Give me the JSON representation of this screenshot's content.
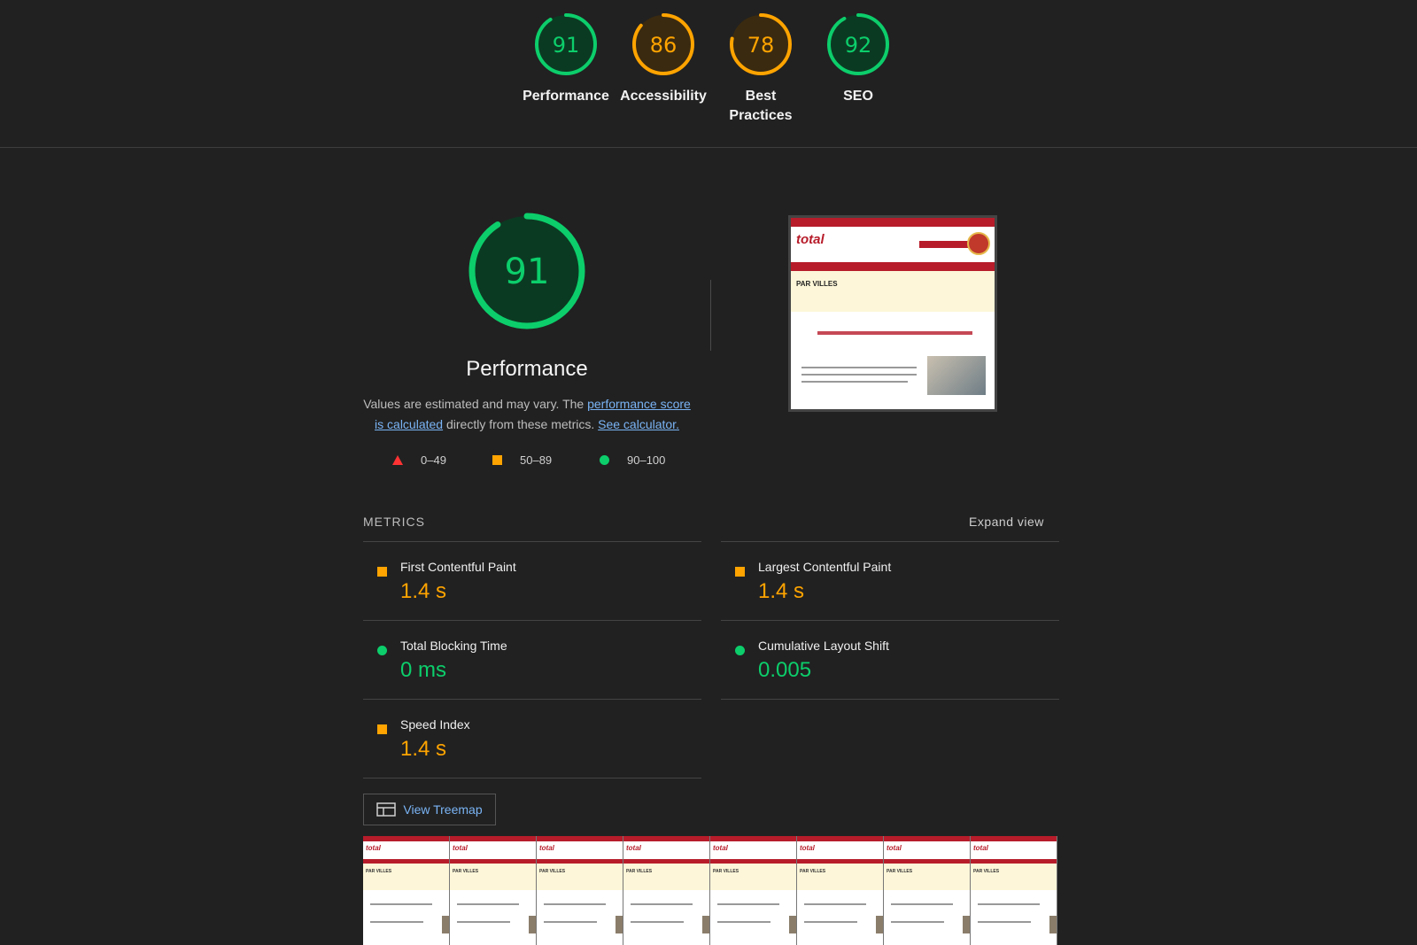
{
  "gauges": [
    {
      "score": 91,
      "label": "Performance",
      "color": "#0cce6b",
      "fill": "#0b3a22"
    },
    {
      "score": 86,
      "label": "Accessibility",
      "color": "#ffa400",
      "fill": "#3a2a10"
    },
    {
      "score": 78,
      "label": "Best Practices",
      "color": "#ffa400",
      "fill": "#3a2a10"
    },
    {
      "score": 92,
      "label": "SEO",
      "color": "#0cce6b",
      "fill": "#0b3a22"
    }
  ],
  "main": {
    "score": 91,
    "title": "Performance",
    "desc_prefix": "Values are estimated and may vary. The ",
    "link_score": "performance score is calculated",
    "desc_mid": " directly from these metrics. ",
    "link_calc": "See calculator."
  },
  "legend": {
    "fail": "0–49",
    "average": "50–89",
    "pass": "90–100"
  },
  "thumbnail": {
    "logo": "total",
    "band_title": "PAR VILLES"
  },
  "metrics": {
    "title": "METRICS",
    "expand": "Expand view",
    "left": [
      {
        "name": "First Contentful Paint",
        "value": "1.4 s",
        "status": "average"
      },
      {
        "name": "Total Blocking Time",
        "value": "0 ms",
        "status": "pass"
      },
      {
        "name": "Speed Index",
        "value": "1.4 s",
        "status": "average"
      }
    ],
    "right": [
      {
        "name": "Largest Contentful Paint",
        "value": "1.4 s",
        "status": "average"
      },
      {
        "name": "Cumulative Layout Shift",
        "value": "0.005",
        "status": "pass"
      }
    ]
  },
  "treemap": {
    "label": "View Treemap"
  },
  "filmstrip": {
    "logo": "total",
    "band_title": "PAR VILLES",
    "count": 8
  }
}
